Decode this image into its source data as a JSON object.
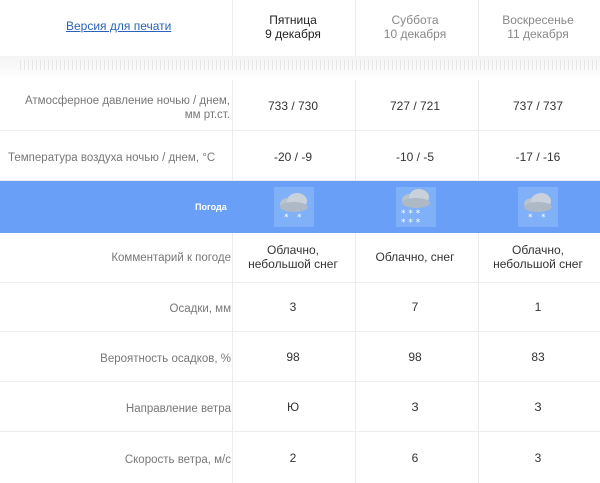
{
  "header": {
    "print_link": "Версия для печати",
    "days": [
      {
        "name": "Пятница",
        "date": "9 декабря"
      },
      {
        "name": "Суббота",
        "date": "10 декабря"
      },
      {
        "name": "Воскресенье",
        "date": "11 декабря"
      }
    ]
  },
  "rows": {
    "pressure": {
      "label_line1": "Атмосферное давление ночью  /  днем,",
      "label_line2": "мм рт.ст.",
      "values": [
        "733 / 730",
        "727 / 721",
        "737 / 737"
      ]
    },
    "temperature": {
      "label": "Температура воздуха ночью  /  днем, °C",
      "values": [
        "-20 / -9",
        "-10 / -5",
        "-17 / -16"
      ]
    },
    "weather": {
      "label": "Погода",
      "icons": [
        "cloud-light-snow-icon",
        "cloud-snow-icon",
        "cloud-light-snow-icon"
      ]
    },
    "comment": {
      "label": "Комментарий к погоде",
      "values": [
        [
          "Облачно,",
          "небольшой снег"
        ],
        [
          "Облачно, снег",
          ""
        ],
        [
          "Облачно,",
          "небольшой снег"
        ]
      ]
    },
    "precip": {
      "label": "Осадки, мм",
      "values": [
        "3",
        "7",
        "1"
      ]
    },
    "prob": {
      "label": "Вероятность осадков, %",
      "values": [
        "98",
        "98",
        "83"
      ]
    },
    "wind_dir": {
      "label": "Направление ветра",
      "values": [
        "Ю",
        "З",
        "З"
      ]
    },
    "wind_speed": {
      "label": "Скорость ветра, м/с",
      "values": [
        "2",
        "6",
        "3"
      ]
    }
  },
  "colors": {
    "accent_band": "#6a9ff7",
    "link": "#2a63b8"
  }
}
